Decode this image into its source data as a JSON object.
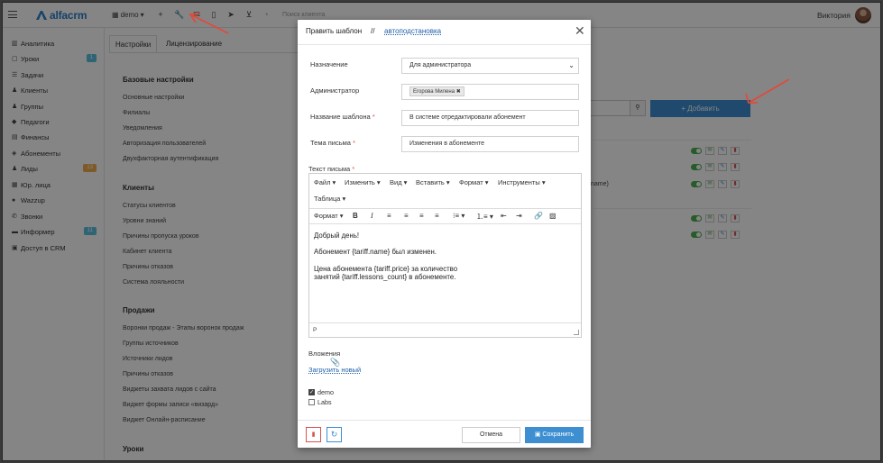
{
  "header": {
    "logo_text": "alfacrm",
    "branch": "demo",
    "search_placeholder": "Поиск клиента",
    "user_name": "Виктория"
  },
  "sidebar": {
    "items": [
      {
        "label": "Аналитика",
        "icon": "chart-icon"
      },
      {
        "label": "Уроки",
        "icon": "calendar-icon",
        "badge": "1"
      },
      {
        "label": "Задачи",
        "icon": "tasks-icon"
      },
      {
        "label": "Клиенты",
        "icon": "user-icon"
      },
      {
        "label": "Группы",
        "icon": "users-icon"
      },
      {
        "label": "Педагоги",
        "icon": "graduation-cap-icon"
      },
      {
        "label": "Финансы",
        "icon": "money-icon"
      },
      {
        "label": "Абонементы",
        "icon": "tag-icon"
      },
      {
        "label": "Лиды",
        "icon": "user-plus-icon",
        "badge": "13"
      },
      {
        "label": "Юр. лица",
        "icon": "building-icon"
      },
      {
        "label": "Wazzup",
        "icon": "whatsapp-icon"
      },
      {
        "label": "Звонки",
        "icon": "phone-icon"
      },
      {
        "label": "Информер",
        "icon": "info-icon",
        "badge": "11"
      },
      {
        "label": "Доступ в CRM",
        "icon": "lock-icon"
      }
    ]
  },
  "settings": {
    "tabs": [
      "Настройки",
      "Лицензирование"
    ],
    "sections": [
      {
        "title": "Базовые настройки",
        "items": [
          "Основные настройки",
          "Филиалы",
          "Уведомления",
          "Авторизация пользователей",
          "Двухфакторная аутентификация"
        ]
      },
      {
        "title": "Клиенты",
        "items": [
          "Статусы клиентов",
          "Уровни знаний",
          "Причины пропуска уроков",
          "Кабинет клиента",
          "Причины отказов",
          "Система лояльности"
        ]
      },
      {
        "title": "Продажи",
        "items": [
          "Воронки продаж - Этапы воронок продаж",
          "Группы источников",
          "Источники лидов",
          "Причины отказов",
          "Виджеты захвата лидов с сайта",
          "Виджет формы записи «визард»",
          "Виджет Онлайн-расписание"
        ]
      },
      {
        "title": "Уроки",
        "items": []
      }
    ]
  },
  "background_right": {
    "add_button": "+ Добавить",
    "fragment_text": "name)"
  },
  "modal": {
    "title": "Править шаблон",
    "separator": "//",
    "link": "автоподстановка",
    "fields": {
      "purpose_label": "Назначение",
      "purpose_value": "Для администратора",
      "admin_label": "Администратор",
      "admin_tag": "Егорова Милена",
      "template_name_label": "Название шаблона",
      "template_name_value": "В системе отредактировали абонемент",
      "subject_label": "Тема письма",
      "subject_value": "Изменения в абонементе",
      "body_label": "Текст письма"
    },
    "editor": {
      "menu": [
        "Файл",
        "Изменить",
        "Вид",
        "Вставить",
        "Формат",
        "Инструменты",
        "Таблица"
      ],
      "format_label": "Формат",
      "content": [
        "Добрый день!",
        "Абонемент {tariff.name} был изменен.",
        "Цена абонемента {tariff.price} за количество",
        "занятий {tariff.lessons_count} в абонементе."
      ],
      "status": "P"
    },
    "attachments_label": "Вложения",
    "upload_link": "Загрузить новый",
    "checkboxes": [
      {
        "label": "demo",
        "checked": true
      },
      {
        "label": "Labs",
        "checked": false
      }
    ],
    "buttons": {
      "cancel": "Отмена",
      "save": "Сохранить"
    }
  },
  "colors": {
    "primary": "#3d8fd1",
    "danger": "#d9534f",
    "success": "#4bae4f",
    "badge_blue": "#5bc0de",
    "badge_orange": "#f0ad4e"
  }
}
